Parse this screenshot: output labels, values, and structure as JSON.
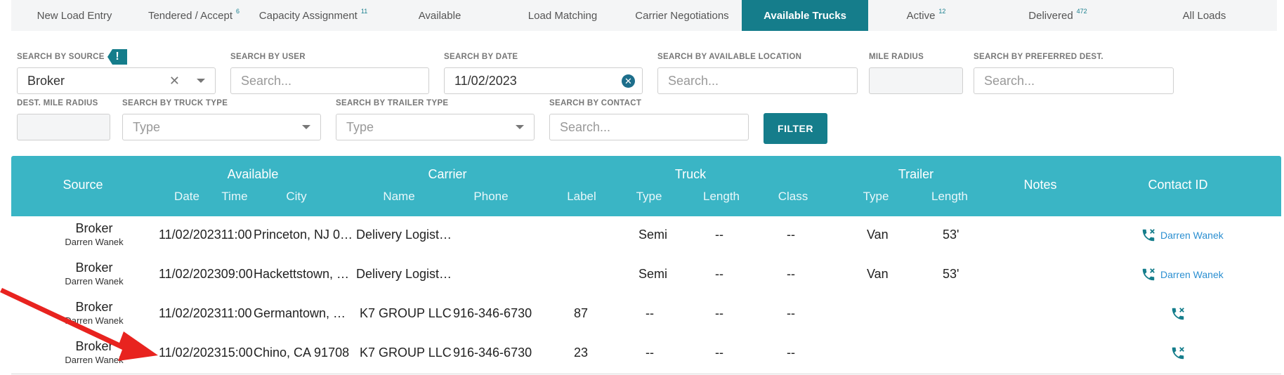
{
  "tabs": [
    {
      "label": "New Load Entry",
      "badge": ""
    },
    {
      "label": "Tendered / Accept",
      "badge": "6"
    },
    {
      "label": "Capacity Assignment",
      "badge": "11"
    },
    {
      "label": "Available",
      "badge": ""
    },
    {
      "label": "Load Matching",
      "badge": ""
    },
    {
      "label": "Carrier Negotiations",
      "badge": ""
    },
    {
      "label": "Available Trucks",
      "badge": ""
    },
    {
      "label": "Active",
      "badge": "12"
    },
    {
      "label": "Delivered",
      "badge": "472"
    },
    {
      "label": "All Loads",
      "badge": ""
    }
  ],
  "filters": {
    "source_label": "SEARCH BY SOURCE",
    "source_value": "Broker",
    "source_info": "!",
    "user_label": "SEARCH BY USER",
    "user_placeholder": "Search...",
    "date_label": "SEARCH BY DATE",
    "date_value": "11/02/2023",
    "location_label": "SEARCH BY AVAILABLE LOCATION",
    "location_placeholder": "Search...",
    "mile_radius_label": "MILE RADIUS",
    "pref_dest_label": "SEARCH BY PREFERRED DEST.",
    "pref_dest_placeholder": "Search...",
    "dest_radius_label": "DEST. MILE RADIUS",
    "truck_type_label": "SEARCH BY TRUCK TYPE",
    "truck_type_placeholder": "Type",
    "trailer_type_label": "SEARCH BY TRAILER TYPE",
    "trailer_type_placeholder": "Type",
    "contact_label": "SEARCH BY CONTACT",
    "contact_placeholder": "Search...",
    "filter_button": "FILTER"
  },
  "table": {
    "headers": {
      "source": "Source",
      "available": "Available",
      "carrier": "Carrier",
      "truck": "Truck",
      "trailer": "Trailer",
      "notes": "Notes",
      "contact_id": "Contact ID",
      "date": "Date",
      "time": "Time",
      "city": "City",
      "name": "Name",
      "phone": "Phone",
      "label": "Label",
      "truck_type": "Type",
      "truck_length": "Length",
      "truck_class": "Class",
      "trailer_type": "Type",
      "trailer_length": "Length"
    },
    "rows": [
      {
        "source": "Broker",
        "user": "Darren Wanek",
        "datetime": "11/02/202311:00",
        "city": "Princeton, NJ 0…",
        "name": "Delivery Logist…",
        "phone": "",
        "label": "",
        "truck_type": "Semi",
        "truck_length": "--",
        "truck_class": "--",
        "trailer_type": "Van",
        "trailer_length": "53'",
        "contact": "Darren Wanek"
      },
      {
        "source": "Broker",
        "user": "Darren Wanek",
        "datetime": "11/02/202309:00",
        "city": "Hackettstown, …",
        "name": "Delivery Logist…",
        "phone": "",
        "label": "",
        "truck_type": "Semi",
        "truck_length": "--",
        "truck_class": "--",
        "trailer_type": "Van",
        "trailer_length": "53'",
        "contact": "Darren Wanek"
      },
      {
        "source": "Broker",
        "user": "Darren Wanek",
        "datetime": "11/02/202311:00",
        "city": "Germantown, …",
        "name": "K7 GROUP LLC",
        "phone": "916-346-6730",
        "label": "87",
        "truck_type": "--",
        "truck_length": "--",
        "truck_class": "--",
        "trailer_type": "",
        "trailer_length": "",
        "contact": ""
      },
      {
        "source": "Broker",
        "user": "Darren Wanek",
        "datetime": "11/02/202315:00",
        "city": "Chino, CA 91708",
        "name": "K7 GROUP LLC",
        "phone": "916-346-6730",
        "label": "23",
        "truck_type": "--",
        "truck_length": "--",
        "truck_class": "--",
        "trailer_type": "",
        "trailer_length": "",
        "contact": ""
      }
    ]
  },
  "colors": {
    "accent": "#157d8b",
    "header_bg": "#3ab5c5",
    "link": "#2b8fd1",
    "annotation_arrow": "#e8231f"
  }
}
